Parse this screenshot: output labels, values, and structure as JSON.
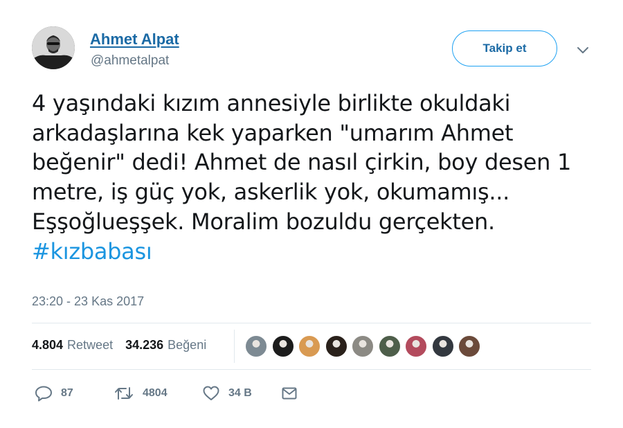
{
  "user": {
    "display_name": "Ahmet Alpat",
    "handle": "@ahmetalpat"
  },
  "follow_button": {
    "label": "Takip et"
  },
  "tweet": {
    "text": "4 yaşındaki kızım annesiyle birlikte okuldaki arkadaşlarına kek yaparken \"umarım Ahmet beğenir\" dedi! Ahmet de nasıl çirkin, boy desen 1 metre, iş güç yok, askerlik yok, okumamış... Eşşoğlueşşek. Moralim bozuldu gerçekten.",
    "hashtag": "#kızbabası",
    "timestamp": "23:20 - 23 Kas 2017"
  },
  "stats": {
    "retweets_value": "4.804",
    "retweets_label": "Retweet",
    "likes_value": "34.236",
    "likes_label": "Beğeni"
  },
  "liker_avatars": [
    {
      "color": "#7d8a93"
    },
    {
      "color": "#1c1c1c"
    },
    {
      "color": "#d99a52"
    },
    {
      "color": "#2a211b"
    },
    {
      "color": "#8c8a84"
    },
    {
      "color": "#4e5e4a"
    },
    {
      "color": "#b34b5d"
    },
    {
      "color": "#33383f"
    },
    {
      "color": "#6b4a3a"
    }
  ],
  "actions": {
    "reply_count": "87",
    "retweet_count": "4804",
    "like_count": "34 B"
  },
  "icons": {
    "reply": "reply-icon",
    "retweet": "retweet-icon",
    "like": "heart-icon",
    "message": "envelope-icon",
    "menu": "chevron-down-icon"
  },
  "colors": {
    "accent": "#1da1f2",
    "link": "#1b95e0",
    "secondary_text": "#657786"
  }
}
